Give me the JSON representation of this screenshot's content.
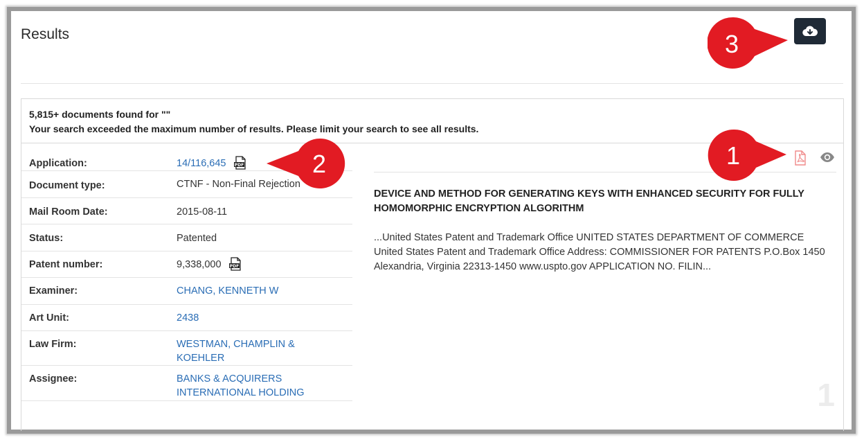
{
  "header": {
    "title": "Results"
  },
  "download": {
    "icon": "cloud-download-icon"
  },
  "summary": {
    "line1": "5,815+ documents found for \"\"",
    "line2": "Your search exceeded the maximum number of results. Please limit your search to see all results."
  },
  "document": {
    "fields": [
      {
        "label": "Application:",
        "value": "14/116,645",
        "link": true,
        "pdf": true
      },
      {
        "label": "Document type:",
        "value": "CTNF - Non-Final Rejection",
        "link": false,
        "pdf": false
      },
      {
        "label": "Mail Room Date:",
        "value": "2015-08-11",
        "link": false,
        "pdf": false
      },
      {
        "label": "Status:",
        "value": "Patented",
        "link": false,
        "pdf": false
      },
      {
        "label": "Patent number:",
        "value": "9,338,000",
        "link": false,
        "pdf": true
      },
      {
        "label": "Examiner:",
        "value": "CHANG, KENNETH W",
        "link": true,
        "pdf": false
      },
      {
        "label": "Art Unit:",
        "value": "2438",
        "link": true,
        "pdf": false
      },
      {
        "label": "Law Firm:",
        "value": "WESTMAN, CHAMPLIN & KOEHLER",
        "link": true,
        "pdf": false
      },
      {
        "label": "Assignee:",
        "value": "BANKS & ACQUIRERS INTERNATIONAL HOLDING",
        "link": true,
        "pdf": false
      }
    ],
    "title": "DEVICE AND METHOD FOR GENERATING KEYS WITH ENHANCED SECURITY FOR FULLY HOMOMORPHIC ENCRYPTION ALGORITHM",
    "snippet": "...United States Patent and Trademark Office UNITED STATES DEPARTMENT OF COMMERCE United States Patent and Trademark Office Address: COMMISSIONER FOR PATENTS P.O.Box 1450 Alexandria, Virginia 22313-1450 www.uspto.gov APPLICATION NO. FILIN...",
    "index": "1"
  },
  "callouts": [
    "1",
    "2",
    "3"
  ],
  "colors": {
    "callout": "#e21b23",
    "link": "#2a6db5",
    "button": "#1f2a36",
    "pdf_red": "#f08a8a"
  }
}
